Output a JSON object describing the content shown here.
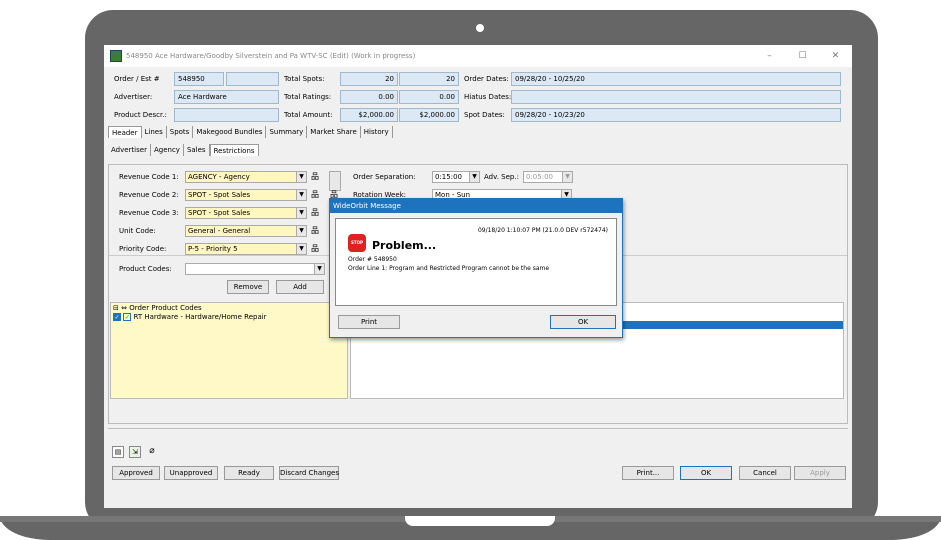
{
  "window": {
    "title": "548950 Ace Hardware/Goodby Silverstein and Pa WTV-SC (Edit) (Work in progress)",
    "minimize": "–",
    "maximize": "☐",
    "close": "✕"
  },
  "header": {
    "order_label": "Order / Est #",
    "order_value": "548950",
    "est_value": "",
    "advertiser_label": "Advertiser:",
    "advertiser_value": "Ace Hardware",
    "product_label": "Product Descr.:",
    "product_value": "",
    "spots_label": "Total Spots:",
    "spots_1": "20",
    "spots_2": "20",
    "ratings_label": "Total Ratings:",
    "ratings_1": "0.00",
    "ratings_2": "0.00",
    "amount_label": "Total Amount:",
    "amount_1": "$2,000.00",
    "amount_2": "$2,000.00",
    "order_dates_label": "Order Dates:",
    "order_dates_value": "09/28/20 - 10/25/20",
    "hiatus_label": "Hiatus Dates:",
    "hiatus_value": "",
    "spot_dates_label": "Spot Dates:",
    "spot_dates_value": "09/28/20 - 10/23/20"
  },
  "tabs": [
    "Header",
    "Lines",
    "Spots",
    "Makegood Bundles",
    "Summary",
    "Market Share",
    "History"
  ],
  "subtabs": [
    "Advertiser",
    "Agency",
    "Sales",
    "Restrictions"
  ],
  "form": {
    "rev1_label": "Revenue Code 1:",
    "rev1_value": "AGENCY - Agency",
    "rev2_label": "Revenue Code 2:",
    "rev2_value": "SPOT - Spot Sales",
    "rev3_label": "Revenue Code 3:",
    "rev3_value": "SPOT - Spot Sales",
    "unit_label": "Unit Code:",
    "unit_value": "General - General",
    "priority_label": "Priority Code:",
    "priority_value": "P-5 - Priority 5",
    "sep_label": "Order Separation:",
    "sep_value": "0:15:00",
    "adv_sep_label": "Adv. Sep.:",
    "adv_sep_value": "0:05:00",
    "rotation_label": "Rotation Week:",
    "rotation_value": "Mon - Sun",
    "product_codes_label": "Product Codes:",
    "remove": "Remove",
    "add": "Add",
    "opc_header": "Order Product Codes",
    "opc_item": "RT Hardware - Hardware/Home Repair"
  },
  "footer": {
    "approved": "Approved",
    "unapproved": "Unapproved",
    "ready": "Ready",
    "discard": "Discard Changes",
    "print": "Print...",
    "ok": "OK",
    "cancel": "Cancel",
    "apply": "Apply"
  },
  "dialog": {
    "title": "WideOrbit Message",
    "timestamp": "09/18/20 1:10:07 PM (21.0.0 DEV r572474)",
    "heading": "Problem...",
    "stop": "STOP",
    "order": "Order # 548950",
    "message": "Order Line 1: Program and Restricted Program cannot be the same",
    "print": "Print",
    "ok": "OK"
  }
}
